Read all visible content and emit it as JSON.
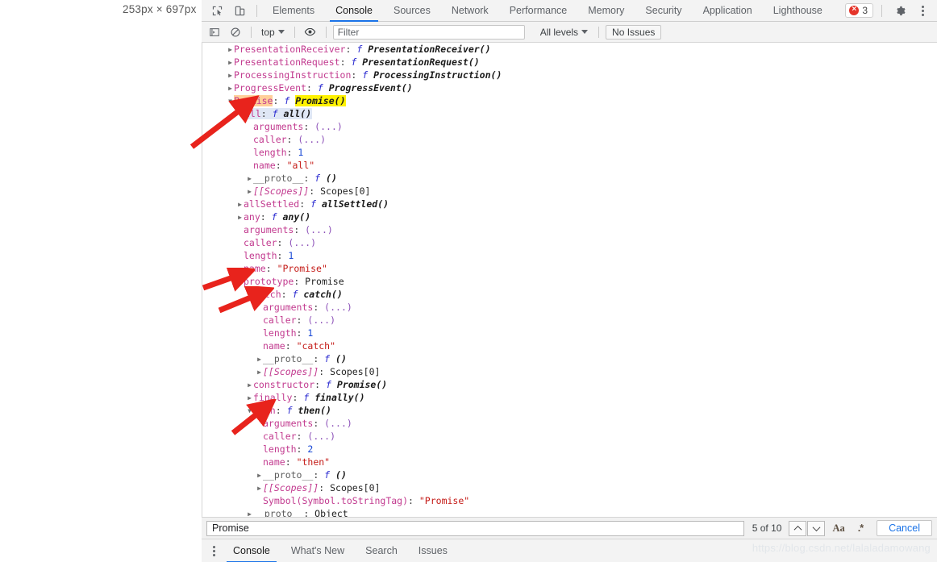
{
  "viewport": {
    "dimensions_label": "253px × 697px"
  },
  "topbar": {
    "icons": [
      "inspect-element-icon",
      "device-toolbar-icon"
    ],
    "tabs": [
      {
        "label": "Elements",
        "active": false
      },
      {
        "label": "Console",
        "active": true
      },
      {
        "label": "Sources",
        "active": false
      },
      {
        "label": "Network",
        "active": false
      },
      {
        "label": "Performance",
        "active": false
      },
      {
        "label": "Memory",
        "active": false
      },
      {
        "label": "Security",
        "active": false
      },
      {
        "label": "Application",
        "active": false
      },
      {
        "label": "Lighthouse",
        "active": false
      }
    ],
    "error_count": "3",
    "settings_icon": "gear-icon",
    "more_icon": "kebab-menu-icon"
  },
  "filterbar": {
    "sidebar_toggle": "show-console-sidebar-icon",
    "clear": "clear-console-icon",
    "context": "top",
    "eye": "live-expression-icon",
    "filter_placeholder": "Filter",
    "filter_value": "",
    "levels": "All levels",
    "issues": "No Issues"
  },
  "console_rows": [
    {
      "indent": 0,
      "tri": "right",
      "segments": [
        {
          "t": "PresentationReceiver",
          "c": "pname"
        },
        {
          "t": ": ",
          "c": "colon"
        },
        {
          "t": "f ",
          "c": "fn-kw"
        },
        {
          "t": "PresentationReceiver()",
          "c": "fn-name"
        }
      ]
    },
    {
      "indent": 0,
      "tri": "right",
      "segments": [
        {
          "t": "PresentationRequest",
          "c": "pname"
        },
        {
          "t": ": ",
          "c": "colon"
        },
        {
          "t": "f ",
          "c": "fn-kw"
        },
        {
          "t": "PresentationRequest()",
          "c": "fn-name"
        }
      ]
    },
    {
      "indent": 0,
      "tri": "right",
      "segments": [
        {
          "t": "ProcessingInstruction",
          "c": "pname"
        },
        {
          "t": ": ",
          "c": "colon"
        },
        {
          "t": "f ",
          "c": "fn-kw"
        },
        {
          "t": "ProcessingInstruction()",
          "c": "fn-name"
        }
      ]
    },
    {
      "indent": 0,
      "tri": "right",
      "segments": [
        {
          "t": "ProgressEvent",
          "c": "pname"
        },
        {
          "t": ": ",
          "c": "colon"
        },
        {
          "t": "f ",
          "c": "fn-kw"
        },
        {
          "t": "ProgressEvent()",
          "c": "fn-name"
        }
      ]
    },
    {
      "indent": 0,
      "tri": "down",
      "segments": [
        {
          "t": "Promise",
          "c": "pname hl-name"
        },
        {
          "t": ": ",
          "c": "colon"
        },
        {
          "t": "f ",
          "c": "fn-kw"
        },
        {
          "t": "Promise()",
          "c": "fn-name hl-val"
        }
      ]
    },
    {
      "indent": 1,
      "tri": "down",
      "selected": true,
      "segments": [
        {
          "t": "all",
          "c": "pname"
        },
        {
          "t": ": ",
          "c": "colon"
        },
        {
          "t": "f ",
          "c": "fn-kw"
        },
        {
          "t": "all()",
          "c": "fn-name"
        }
      ]
    },
    {
      "indent": 2,
      "tri": "none",
      "segments": [
        {
          "t": "arguments",
          "c": "pname"
        },
        {
          "t": ": ",
          "c": "colon"
        },
        {
          "t": "(...)",
          "c": "dots"
        }
      ]
    },
    {
      "indent": 2,
      "tri": "none",
      "segments": [
        {
          "t": "caller",
          "c": "pname"
        },
        {
          "t": ": ",
          "c": "colon"
        },
        {
          "t": "(...)",
          "c": "dots"
        }
      ]
    },
    {
      "indent": 2,
      "tri": "none",
      "segments": [
        {
          "t": "length",
          "c": "pname"
        },
        {
          "t": ": ",
          "c": "colon"
        },
        {
          "t": "1",
          "c": "num"
        }
      ]
    },
    {
      "indent": 2,
      "tri": "none",
      "segments": [
        {
          "t": "name",
          "c": "pname"
        },
        {
          "t": ": ",
          "c": "colon"
        },
        {
          "t": "\"all\"",
          "c": "str"
        }
      ]
    },
    {
      "indent": 2,
      "tri": "right",
      "segments": [
        {
          "t": "__proto__",
          "c": "pname dark"
        },
        {
          "t": ": ",
          "c": "colon"
        },
        {
          "t": "f ",
          "c": "fn-kw"
        },
        {
          "t": "()",
          "c": "fn-name"
        }
      ]
    },
    {
      "indent": 2,
      "tri": "right",
      "segments": [
        {
          "t": "[[Scopes]]",
          "c": "pname internal"
        },
        {
          "t": ": ",
          "c": "colon"
        },
        {
          "t": "Scopes[0]",
          "c": "plain"
        }
      ]
    },
    {
      "indent": 1,
      "tri": "right",
      "segments": [
        {
          "t": "allSettled",
          "c": "pname"
        },
        {
          "t": ": ",
          "c": "colon"
        },
        {
          "t": "f ",
          "c": "fn-kw"
        },
        {
          "t": "allSettled()",
          "c": "fn-name"
        }
      ]
    },
    {
      "indent": 1,
      "tri": "right",
      "segments": [
        {
          "t": "any",
          "c": "pname"
        },
        {
          "t": ": ",
          "c": "colon"
        },
        {
          "t": "f ",
          "c": "fn-kw"
        },
        {
          "t": "any()",
          "c": "fn-name"
        }
      ]
    },
    {
      "indent": 1,
      "tri": "none",
      "segments": [
        {
          "t": "arguments",
          "c": "pname"
        },
        {
          "t": ": ",
          "c": "colon"
        },
        {
          "t": "(...)",
          "c": "dots"
        }
      ]
    },
    {
      "indent": 1,
      "tri": "none",
      "segments": [
        {
          "t": "caller",
          "c": "pname"
        },
        {
          "t": ": ",
          "c": "colon"
        },
        {
          "t": "(...)",
          "c": "dots"
        }
      ]
    },
    {
      "indent": 1,
      "tri": "none",
      "segments": [
        {
          "t": "length",
          "c": "pname"
        },
        {
          "t": ": ",
          "c": "colon"
        },
        {
          "t": "1",
          "c": "num"
        }
      ]
    },
    {
      "indent": 1,
      "tri": "none",
      "segments": [
        {
          "t": "name",
          "c": "pname"
        },
        {
          "t": ": ",
          "c": "colon"
        },
        {
          "t": "\"Promise\"",
          "c": "str"
        }
      ]
    },
    {
      "indent": 1,
      "tri": "down",
      "segments": [
        {
          "t": "prototype",
          "c": "pname"
        },
        {
          "t": ": ",
          "c": "colon"
        },
        {
          "t": "Promise",
          "c": "plain"
        }
      ]
    },
    {
      "indent": 2,
      "tri": "down",
      "segments": [
        {
          "t": "catch",
          "c": "pname"
        },
        {
          "t": ": ",
          "c": "colon"
        },
        {
          "t": "f ",
          "c": "fn-kw"
        },
        {
          "t": "catch()",
          "c": "fn-name"
        }
      ]
    },
    {
      "indent": 3,
      "tri": "none",
      "segments": [
        {
          "t": "arguments",
          "c": "pname"
        },
        {
          "t": ": ",
          "c": "colon"
        },
        {
          "t": "(...)",
          "c": "dots"
        }
      ]
    },
    {
      "indent": 3,
      "tri": "none",
      "segments": [
        {
          "t": "caller",
          "c": "pname"
        },
        {
          "t": ": ",
          "c": "colon"
        },
        {
          "t": "(...)",
          "c": "dots"
        }
      ]
    },
    {
      "indent": 3,
      "tri": "none",
      "segments": [
        {
          "t": "length",
          "c": "pname"
        },
        {
          "t": ": ",
          "c": "colon"
        },
        {
          "t": "1",
          "c": "num"
        }
      ]
    },
    {
      "indent": 3,
      "tri": "none",
      "segments": [
        {
          "t": "name",
          "c": "pname"
        },
        {
          "t": ": ",
          "c": "colon"
        },
        {
          "t": "\"catch\"",
          "c": "str"
        }
      ]
    },
    {
      "indent": 3,
      "tri": "right",
      "segments": [
        {
          "t": "__proto__",
          "c": "pname dark"
        },
        {
          "t": ": ",
          "c": "colon"
        },
        {
          "t": "f ",
          "c": "fn-kw"
        },
        {
          "t": "()",
          "c": "fn-name"
        }
      ]
    },
    {
      "indent": 3,
      "tri": "right",
      "segments": [
        {
          "t": "[[Scopes]]",
          "c": "pname internal"
        },
        {
          "t": ": ",
          "c": "colon"
        },
        {
          "t": "Scopes[0]",
          "c": "plain"
        }
      ]
    },
    {
      "indent": 2,
      "tri": "right",
      "segments": [
        {
          "t": "constructor",
          "c": "pname"
        },
        {
          "t": ": ",
          "c": "colon"
        },
        {
          "t": "f ",
          "c": "fn-kw"
        },
        {
          "t": "Promise()",
          "c": "fn-name"
        }
      ]
    },
    {
      "indent": 2,
      "tri": "right",
      "segments": [
        {
          "t": "finally",
          "c": "pname"
        },
        {
          "t": ": ",
          "c": "colon"
        },
        {
          "t": "f ",
          "c": "fn-kw"
        },
        {
          "t": "finally()",
          "c": "fn-name"
        }
      ]
    },
    {
      "indent": 2,
      "tri": "down",
      "segments": [
        {
          "t": "then",
          "c": "pname"
        },
        {
          "t": ": ",
          "c": "colon"
        },
        {
          "t": "f ",
          "c": "fn-kw"
        },
        {
          "t": "then()",
          "c": "fn-name"
        }
      ]
    },
    {
      "indent": 3,
      "tri": "none",
      "segments": [
        {
          "t": "arguments",
          "c": "pname"
        },
        {
          "t": ": ",
          "c": "colon"
        },
        {
          "t": "(...)",
          "c": "dots"
        }
      ]
    },
    {
      "indent": 3,
      "tri": "none",
      "segments": [
        {
          "t": "caller",
          "c": "pname"
        },
        {
          "t": ": ",
          "c": "colon"
        },
        {
          "t": "(...)",
          "c": "dots"
        }
      ]
    },
    {
      "indent": 3,
      "tri": "none",
      "segments": [
        {
          "t": "length",
          "c": "pname"
        },
        {
          "t": ": ",
          "c": "colon"
        },
        {
          "t": "2",
          "c": "num"
        }
      ]
    },
    {
      "indent": 3,
      "tri": "none",
      "segments": [
        {
          "t": "name",
          "c": "pname"
        },
        {
          "t": ": ",
          "c": "colon"
        },
        {
          "t": "\"then\"",
          "c": "str"
        }
      ]
    },
    {
      "indent": 3,
      "tri": "right",
      "segments": [
        {
          "t": "__proto__",
          "c": "pname dark"
        },
        {
          "t": ": ",
          "c": "colon"
        },
        {
          "t": "f ",
          "c": "fn-kw"
        },
        {
          "t": "()",
          "c": "fn-name"
        }
      ]
    },
    {
      "indent": 3,
      "tri": "right",
      "segments": [
        {
          "t": "[[Scopes]]",
          "c": "pname internal"
        },
        {
          "t": ": ",
          "c": "colon"
        },
        {
          "t": "Scopes[0]",
          "c": "plain"
        }
      ]
    },
    {
      "indent": 3,
      "tri": "none",
      "segments": [
        {
          "t": "Symbol(Symbol.toStringTag)",
          "c": "pname"
        },
        {
          "t": ": ",
          "c": "colon"
        },
        {
          "t": "\"Promise\"",
          "c": "str"
        }
      ]
    },
    {
      "indent": 2,
      "tri": "right",
      "segments": [
        {
          "t": "__proto__",
          "c": "pname dark"
        },
        {
          "t": ": ",
          "c": "colon"
        },
        {
          "t": "Object",
          "c": "plain"
        }
      ]
    }
  ],
  "searchbar": {
    "query": "Promise",
    "matches": "5 of 10",
    "prev_icon": "chevron-up-icon",
    "next_icon": "chevron-down-icon",
    "match_case_label": "Aa",
    "regex_label": ".*",
    "cancel_label": "Cancel"
  },
  "drawer": {
    "more_icon": "kebab-menu-icon",
    "tabs": [
      {
        "label": "Console",
        "active": true
      },
      {
        "label": "What's New",
        "active": false
      },
      {
        "label": "Search",
        "active": false
      },
      {
        "label": "Issues",
        "active": false
      }
    ]
  },
  "watermark": "https://blog.csdn.net/lalaladamowang",
  "colors": {
    "accent": "#1a73e8",
    "error": "#e5342a",
    "highlight_name": "#ffcf9a",
    "highlight_value": "#fff200",
    "selection": "#dfe7f5",
    "annotation_arrow": "#e8231c"
  },
  "annotations": [
    {
      "name": "arrow-to-all",
      "target": "all"
    },
    {
      "name": "arrow-to-prototype",
      "target": "prototype"
    },
    {
      "name": "arrow-to-catch",
      "target": "catch"
    },
    {
      "name": "arrow-to-then",
      "target": "then"
    }
  ]
}
